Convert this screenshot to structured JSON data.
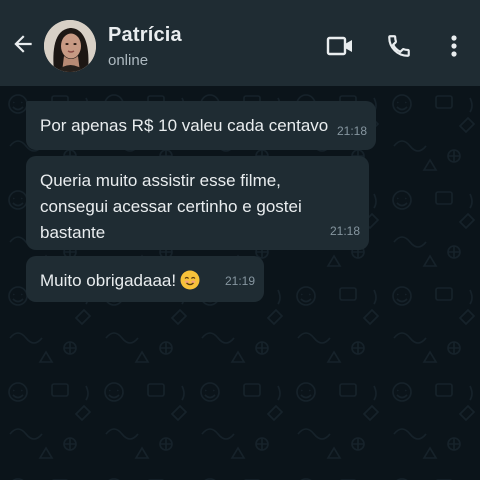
{
  "header": {
    "contact_name": "Patrícia",
    "status": "online",
    "icons": {
      "back": "arrow-left-icon",
      "video": "video-camera-icon",
      "call": "phone-icon",
      "menu": "more-vertical-icon"
    }
  },
  "messages": [
    {
      "text": "Por apenas R$ 10 valeu cada centavo",
      "time": "21:18"
    },
    {
      "text": "Queria muito assistir esse filme,\nconsegui acessar certinho e gostei\nbastante",
      "time": "21:18"
    },
    {
      "text": "Muito obrigadaaa!",
      "emoji": "smiling-face-emoji",
      "time": "21:19"
    }
  ],
  "colors": {
    "header_bg": "#1f2c33",
    "chat_bg": "#0b141a",
    "bubble_bg": "#1f2c33",
    "text_primary": "#e9edef",
    "text_secondary": "#8696a0"
  }
}
